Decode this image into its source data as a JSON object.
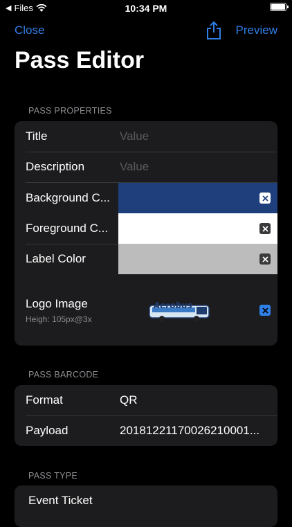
{
  "status_bar": {
    "carrier": "Files",
    "time": "10:34 PM"
  },
  "nav": {
    "close_label": "Close",
    "preview_label": "Preview"
  },
  "page_title": "Pass Editor",
  "pass_properties": {
    "header": "PASS PROPERTIES",
    "title_label": "Title",
    "title_placeholder": "Value",
    "description_label": "Description",
    "description_placeholder": "Value",
    "background_label": "Background C...",
    "foreground_label": "Foreground C...",
    "label_color_label": "Label Color",
    "logo_label": "Logo Image",
    "logo_sub": "Heigh: 105px@3x",
    "logo_brand_text": "Aerobus",
    "colors": {
      "background": "#1e3f7b",
      "foreground": "#ffffff",
      "label": "#bcbcbc",
      "accent": "#2f7fe8"
    }
  },
  "pass_barcode": {
    "header": "PASS BARCODE",
    "format_label": "Format",
    "format_value": "QR",
    "payload_label": "Payload",
    "payload_value": "20181221170026210001..."
  },
  "pass_type": {
    "header": "PASS TYPE",
    "selected": "Event Ticket"
  }
}
